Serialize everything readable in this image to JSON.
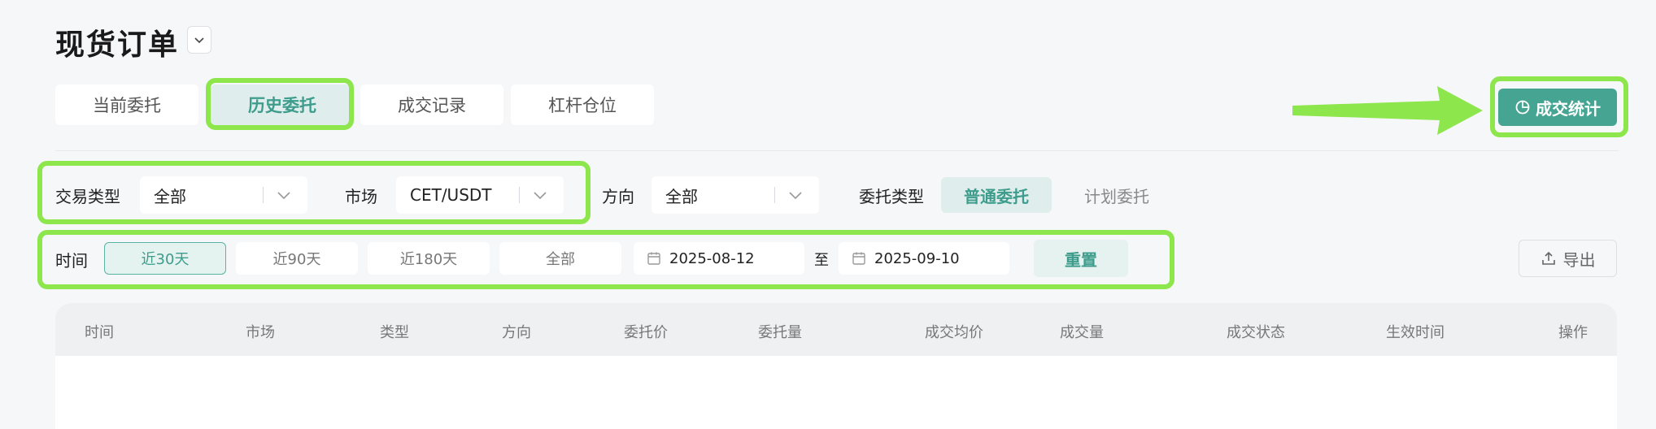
{
  "header": {
    "title": "现货订单"
  },
  "tabs": [
    {
      "label": "当前委托",
      "active": false
    },
    {
      "label": "历史委托",
      "active": true
    },
    {
      "label": "成交记录",
      "active": false
    },
    {
      "label": "杠杆仓位",
      "active": false
    }
  ],
  "stats_button": {
    "label": "成交统计",
    "icon": "pie-chart-icon"
  },
  "filters": {
    "trade_type": {
      "label": "交易类型",
      "value": "全部"
    },
    "market": {
      "label": "市场",
      "value": "CET/USDT"
    },
    "direction": {
      "label": "方向",
      "value": "全部"
    },
    "order_type": {
      "label": "委托类型",
      "options": [
        "普通委托",
        "计划委托"
      ],
      "selected": "普通委托"
    }
  },
  "time_filter": {
    "label": "时间",
    "ranges": [
      "近30天",
      "近90天",
      "近180天",
      "全部"
    ],
    "selected": "近30天",
    "start_date": "2025-08-12",
    "separator": "至",
    "end_date": "2025-09-10",
    "reset_label": "重置"
  },
  "export_button": {
    "label": "导出"
  },
  "table": {
    "columns": [
      "时间",
      "市场",
      "类型",
      "方向",
      "委托价",
      "委托量",
      "成交均价",
      "成交量",
      "成交状态",
      "生效时间",
      "操作"
    ]
  },
  "colors": {
    "accent": "#45a592",
    "accent_light": "#dfeeec",
    "highlight": "#8de64b",
    "background": "#f6f7f9"
  }
}
